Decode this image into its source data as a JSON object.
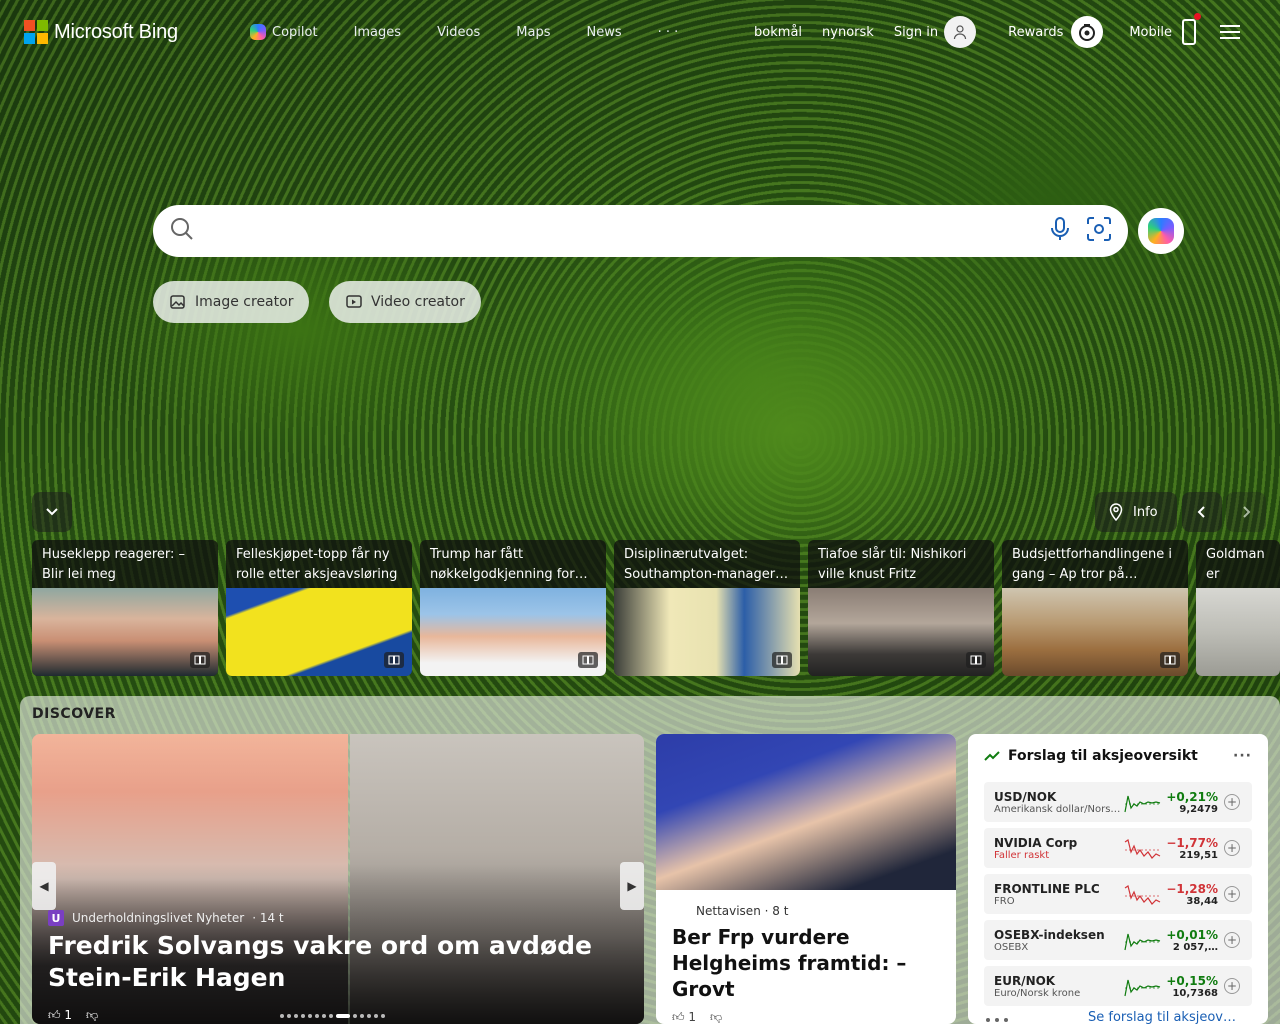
{
  "brand": {
    "name": "Microsoft Bing",
    "logo_colors": [
      "#f25022",
      "#7fba00",
      "#00a4ef",
      "#ffb900"
    ]
  },
  "nav": {
    "items": [
      "Copilot",
      "Images",
      "Videos",
      "Maps",
      "News"
    ],
    "more": "· · ·"
  },
  "header_right": {
    "lang1": "bokmål",
    "lang2": "nynorsk",
    "signin": "Sign in",
    "rewards": "Rewards",
    "mobile": "Mobile"
  },
  "search": {
    "value": "",
    "placeholder": ""
  },
  "pills": {
    "image_creator": "Image creator",
    "video_creator": "Video creator"
  },
  "carousel": {
    "info": "Info"
  },
  "news": [
    {
      "title": "Huseklepp reagerer: – Blir lei meg"
    },
    {
      "title": "Felleskjøpet-topp får ny rolle etter aksjeavsløring"
    },
    {
      "title": "Trump har fått nøkkelgodkjenning for…"
    },
    {
      "title": "Disiplinærutvalget: Southampton-manager…"
    },
    {
      "title": "Tiafoe slår til: Nishikori ville knust Fritz"
    },
    {
      "title": "Budsjettforhandlingene i gang – Ap tror på…"
    },
    {
      "title": "Goldman er fortsatt…"
    }
  ],
  "discover": {
    "label": "DISCOVER",
    "hero": {
      "source": "Underholdningslivet Nyheter",
      "age": "· 14 t",
      "title": "Fredrik Solvangs vakre ord om avdøde Stein-Erik Hagen",
      "likes": "1"
    },
    "second": {
      "source": "Nettavisen",
      "age": "· 8 t",
      "title": "Ber Frp vurdere Helgheims framtid: – Grovt",
      "likes": "1"
    }
  },
  "stocks": {
    "title": "Forslag til aksjeoversikt",
    "more": "···",
    "footer": "Se forslag til aksjeov…",
    "rows": [
      {
        "symbol": "USD/NOK",
        "name": "Amerikansk dollar/Nors…",
        "change": "+0,21%",
        "price": "9,2479",
        "dir": "up"
      },
      {
        "symbol": "NVIDIA Corp",
        "name": "Faller raskt",
        "change": "−1,77%",
        "price": "219,51",
        "dir": "down"
      },
      {
        "symbol": "FRONTLINE PLC",
        "name": "FRO",
        "change": "−1,28%",
        "price": "38,44",
        "dir": "down"
      },
      {
        "symbol": "OSEBX-indeksen",
        "name": "OSEBX",
        "change": "+0,01%",
        "price": "2 057,…",
        "dir": "up"
      },
      {
        "symbol": "EUR/NOK",
        "name": "Euro/Norsk krone",
        "change": "+0,15%",
        "price": "10,7368",
        "dir": "up"
      }
    ]
  },
  "colors": {
    "up": "#107c10",
    "down": "#d13438",
    "link": "#1a5fb4"
  }
}
